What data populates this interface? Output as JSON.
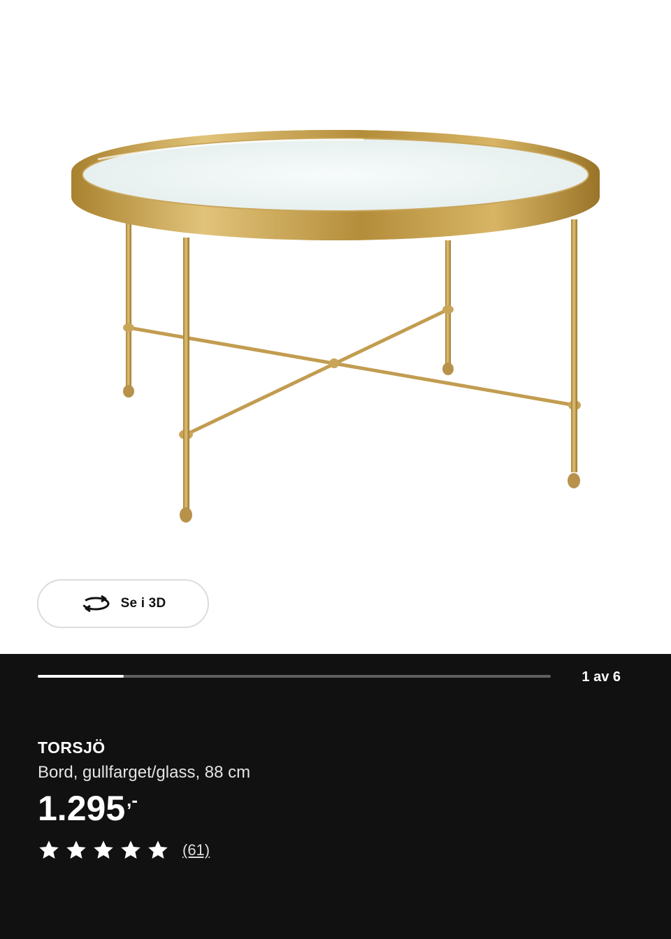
{
  "gallery": {
    "view_3d_label": "Se i 3D",
    "counter": "1 av 6",
    "progress": 0.167,
    "icon": "rotate-3d-icon"
  },
  "product": {
    "name": "TORSJÖ",
    "description": "Bord, gullfarget/glass, 88 cm",
    "price": "1.295",
    "price_suffix": ",-",
    "rating": 5,
    "review_count": "(61)"
  },
  "colors": {
    "panel_background": "#111111",
    "gold": "#c9a24e",
    "text": "#ffffff"
  }
}
